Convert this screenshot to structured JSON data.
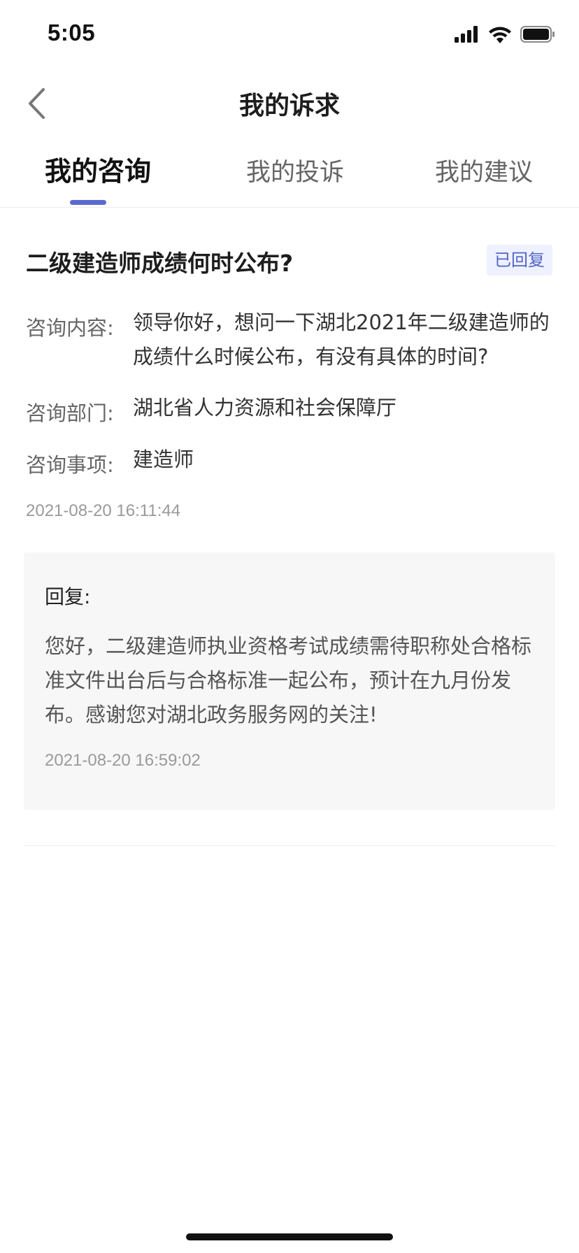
{
  "status_bar": {
    "time": "5:05"
  },
  "nav": {
    "title": "我的诉求",
    "back_icon": "chevron-left-icon"
  },
  "tabs": [
    {
      "label": "我的咨询",
      "active": true
    },
    {
      "label": "我的投诉",
      "active": false
    },
    {
      "label": "我的建议",
      "active": false
    }
  ],
  "consultation": {
    "title": "二级建造师成绩何时公布?",
    "status": "已回复",
    "content_label": "咨询内容:",
    "content_value": "领导你好，想问一下湖北2021年二级建造师的成绩什么时候公布，有没有具体的时间?",
    "department_label": "咨询部门:",
    "department_value": "湖北省人力资源和社会保障厅",
    "matter_label": "咨询事项:",
    "matter_value": "建造师",
    "timestamp": "2021-08-20 16:11:44"
  },
  "reply": {
    "heading": "回复:",
    "body": "您好，二级建造师执业资格考试成绩需待职称处合格标准文件出台后与合格标准一起公布，预计在九月份发布。感谢您对湖北政务服务网的关注!",
    "timestamp": "2021-08-20 16:59:02"
  },
  "colors": {
    "accent": "#5b6ad0",
    "badge_bg": "#eef1ff",
    "badge_text": "#5263c8",
    "reply_bg": "#f7f7f7"
  }
}
